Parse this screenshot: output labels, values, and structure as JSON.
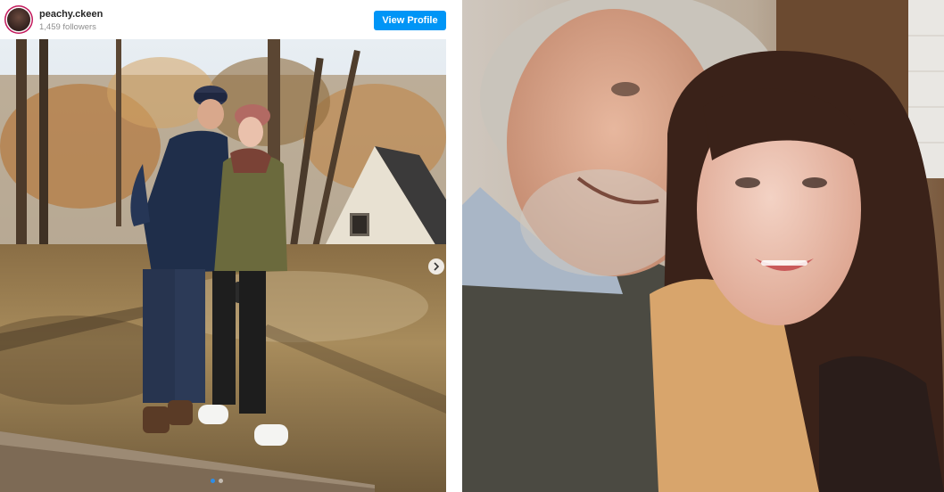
{
  "post": {
    "username": "peachy.ckeen",
    "followers": "1,459 followers",
    "view_profile_label": "View Profile"
  },
  "icons": {
    "avatar": "profile-avatar",
    "next": "chevron-right-icon"
  },
  "colors": {
    "button": "#0095f6",
    "active_dot": "#2e8de6",
    "story_ring": "#c2185b"
  }
}
